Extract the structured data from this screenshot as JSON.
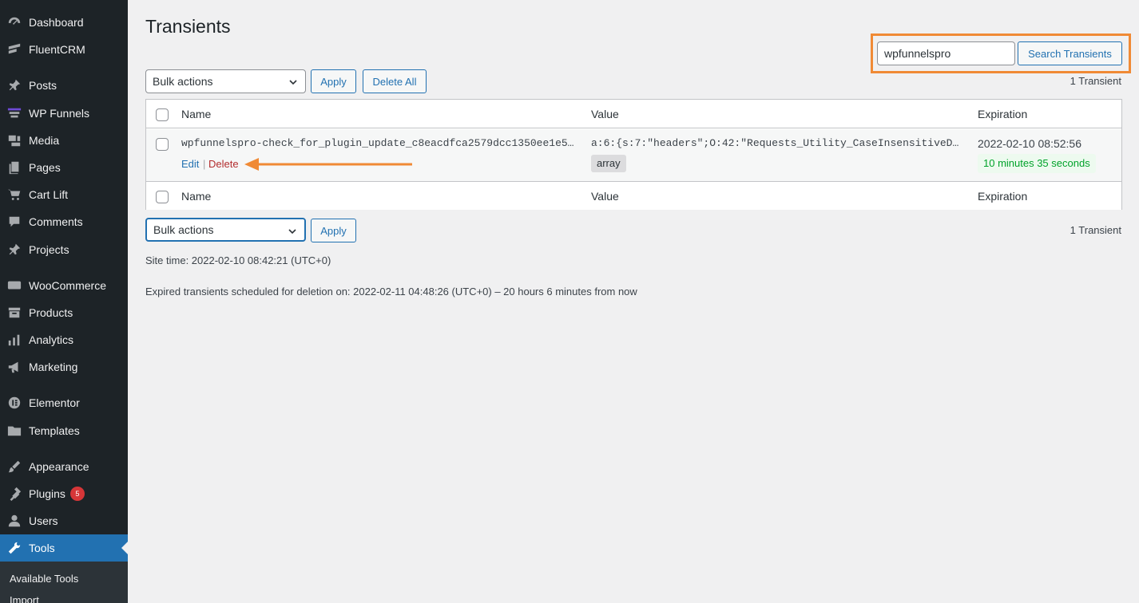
{
  "sidebar": {
    "items": [
      {
        "label": "Dashboard",
        "icon": "dashboard-icon"
      },
      {
        "label": "FluentCRM",
        "icon": "fluentcrm-icon"
      },
      {
        "label": "Posts",
        "icon": "pin-icon"
      },
      {
        "label": "WP Funnels",
        "icon": "funnel-icon"
      },
      {
        "label": "Media",
        "icon": "media-icon"
      },
      {
        "label": "Pages",
        "icon": "pages-icon"
      },
      {
        "label": "Cart Lift",
        "icon": "cart-icon"
      },
      {
        "label": "Comments",
        "icon": "comment-icon"
      },
      {
        "label": "Projects",
        "icon": "pin-icon"
      },
      {
        "label": "WooCommerce",
        "icon": "woo-icon"
      },
      {
        "label": "Products",
        "icon": "archive-icon"
      },
      {
        "label": "Analytics",
        "icon": "bar-chart-icon"
      },
      {
        "label": "Marketing",
        "icon": "megaphone-icon"
      },
      {
        "label": "Elementor",
        "icon": "elementor-icon"
      },
      {
        "label": "Templates",
        "icon": "folder-icon"
      },
      {
        "label": "Appearance",
        "icon": "brush-icon"
      },
      {
        "label": "Plugins",
        "icon": "plugin-icon",
        "badge": "5"
      },
      {
        "label": "Users",
        "icon": "user-icon"
      },
      {
        "label": "Tools",
        "icon": "wrench-icon",
        "active": true
      }
    ],
    "submenu": [
      "Available Tools",
      "Import"
    ]
  },
  "page": {
    "title": "Transients",
    "search_value": "wpfunnelspro",
    "search_button": "Search Transients",
    "bulk_actions": "Bulk actions",
    "apply": "Apply",
    "delete_all": "Delete All",
    "count": "1 Transient"
  },
  "table": {
    "columns": [
      "Name",
      "Value",
      "Expiration"
    ],
    "rows": [
      {
        "name": "wpfunnelspro-check_for_plugin_update_c8eacdfca2579dcc1350ee1e5…",
        "value": "a:6:{s:7:\"headers\";O:42:\"Requests_Utility_CaseInsensitiveD…",
        "type": "array",
        "expiration_date": "2022-02-10 08:52:56",
        "expiration_remaining": "10 minutes 35 seconds",
        "actions": {
          "edit": "Edit",
          "separator": "|",
          "delete": "Delete"
        }
      }
    ]
  },
  "footer": {
    "site_time": "Site time: 2022-02-10 08:42:21 (UTC+0)",
    "scheduled": "Expired transients scheduled for deletion on: 2022-02-11 04:48:26 (UTC+0) – 20 hours 6 minutes from now"
  },
  "colors": {
    "highlight": "#f08a35",
    "accent": "#2271b1",
    "sidebar_bg": "#1d2327",
    "delete": "#b32d2e",
    "success": "#00a32a"
  }
}
